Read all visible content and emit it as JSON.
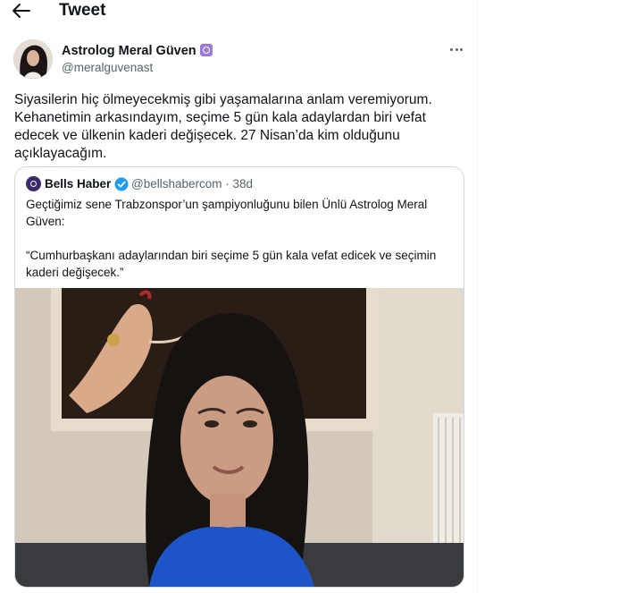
{
  "header": {
    "title": "Tweet"
  },
  "tweet": {
    "author_name": "Astrolog Meral Güven",
    "author_handle": "@meralguvenast",
    "text": "Siyasilerin hiç ölmeyecekmiş gibi yaşamalarına anlam veremiyorum.\nKehanetimin arkasındayım, seçime 5 gün kala adaylardan biri vefat\nedecek ve ülkenin kaderi değişecek. 27 Nisan’da kim olduğunu\naçıklayacağım."
  },
  "quoted": {
    "name": "Bells Haber",
    "handle": "@bellshabercom · 38d",
    "text": "Geçtiğimiz sene Trabzonspor’un şampiyonluğunu bilen Ünlü Astrolog Meral\nGüven:\n\n“Cumhurbaşkanı adaylarından biri seçime 5 gün kala vefat edicek ve seçimin\nkaderi değişecek.”"
  },
  "colors": {
    "text": "#0f1419",
    "secondary": "#536471",
    "border": "#cfd9de",
    "verified": "#1d9bf0",
    "badge": "#9a7bd8",
    "shirt": "#1d54c8"
  },
  "icons": [
    "back-arrow-icon",
    "more-icon",
    "verified-icon"
  ]
}
